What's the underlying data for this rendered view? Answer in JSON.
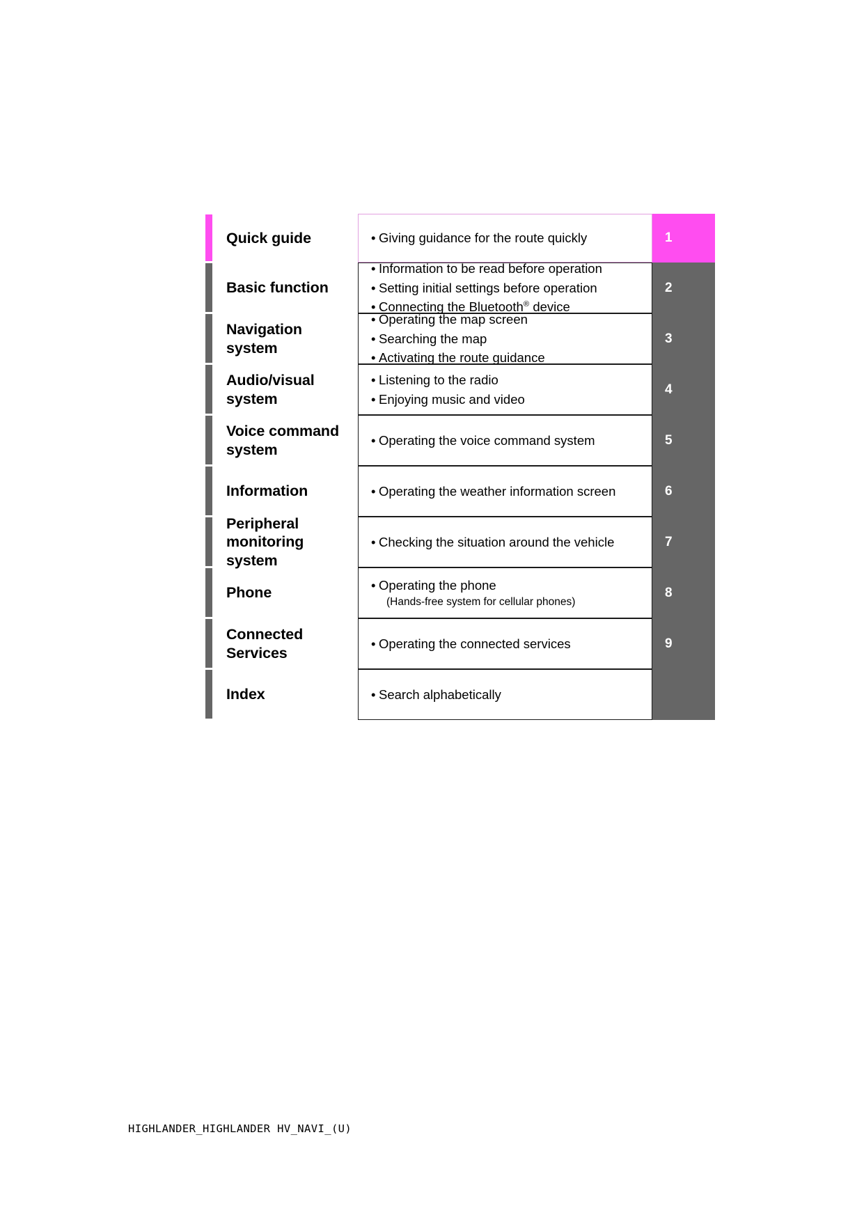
{
  "document": {
    "footer_text": "HIGHLANDER_HIGHLANDER HV_NAVI_(U)"
  },
  "colors": {
    "accent": "#ff4df0",
    "tab_gray": "#666666",
    "accent_border": "#e2a0e0",
    "border": "#1a1a1a",
    "text": "#000000",
    "tab_text": "#ffffff"
  },
  "toc": {
    "rows": [
      {
        "title": "Quick guide",
        "tab_number": "1",
        "accent": true,
        "lines": [
          {
            "text": "Giving guidance for the route quickly",
            "type": "bullet"
          }
        ]
      },
      {
        "title": "Basic function",
        "tab_number": "2",
        "accent": false,
        "lines": [
          {
            "text": "Information to be read before operation",
            "type": "bullet"
          },
          {
            "text": "Setting initial settings before operation",
            "type": "bullet"
          },
          {
            "text": "Connecting the Bluetooth® device",
            "type": "bullet-sup",
            "pre": "Connecting the Bluetooth",
            "sup": "®",
            "post": " device"
          }
        ]
      },
      {
        "title": "Navigation system",
        "title_line1": "Navigation",
        "title_line2": "system",
        "tab_number": "3",
        "accent": false,
        "lines": [
          {
            "text": "Operating the map screen",
            "type": "bullet"
          },
          {
            "text": "Searching the map",
            "type": "bullet"
          },
          {
            "text": "Activating the route guidance",
            "type": "bullet"
          }
        ]
      },
      {
        "title": "Audio/visual system",
        "title_line1": "Audio/visual",
        "title_line2": "system",
        "tab_number": "4",
        "accent": false,
        "lines": [
          {
            "text": "Listening to the radio",
            "type": "bullet"
          },
          {
            "text": "Enjoying music and video",
            "type": "bullet"
          }
        ]
      },
      {
        "title": "Voice command system",
        "title_line1": "Voice command",
        "title_line2": "system",
        "tab_number": "5",
        "accent": false,
        "lines": [
          {
            "text": "Operating the voice command system",
            "type": "bullet"
          }
        ]
      },
      {
        "title": "Information",
        "tab_number": "6",
        "accent": false,
        "lines": [
          {
            "text": "Operating the weather information screen",
            "type": "bullet"
          }
        ]
      },
      {
        "title": "Peripheral monitoring system",
        "title_line1": "Peripheral",
        "title_line2": "monitoring",
        "title_line3": "system",
        "tab_number": "7",
        "accent": false,
        "lines": [
          {
            "text": "Checking the situation around the vehicle",
            "type": "bullet"
          }
        ]
      },
      {
        "title": "Phone",
        "tab_number": "8",
        "accent": false,
        "lines": [
          {
            "text": "Operating the phone",
            "type": "bullet"
          },
          {
            "text": "(Hands-free system for cellular phones)",
            "type": "sub"
          }
        ]
      },
      {
        "title": "Connected Services",
        "title_line1": "Connected",
        "title_line2": "Services",
        "tab_number": "9",
        "accent": false,
        "lines": [
          {
            "text": "Operating the connected services",
            "type": "bullet"
          }
        ]
      },
      {
        "title": "Index",
        "tab_number": "",
        "accent": false,
        "lines": [
          {
            "text": "Search alphabetically",
            "type": "bullet"
          }
        ]
      }
    ]
  }
}
